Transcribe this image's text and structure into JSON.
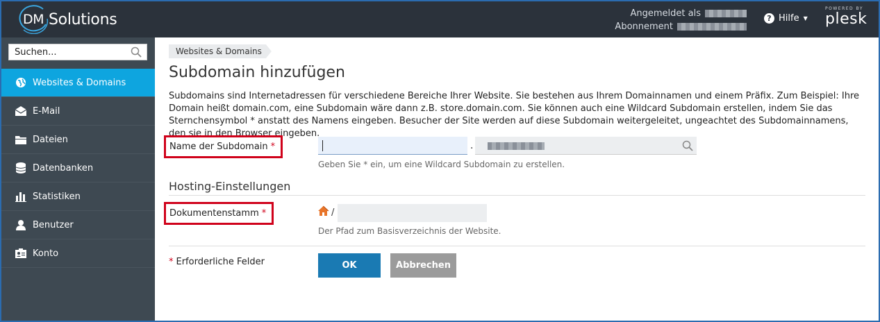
{
  "header": {
    "logo_dm": "DM",
    "logo_solutions": "Solutions",
    "logged_in_label": "Angemeldet als",
    "subscription_label": "Abonnement",
    "help_label": "Hilfe",
    "powered_by": "POWERED BY",
    "plesk": "plesk"
  },
  "sidebar": {
    "search_placeholder": "Suchen...",
    "items": [
      {
        "label": "Websites & Domains",
        "icon": "globe-icon",
        "active": true
      },
      {
        "label": "E-Mail",
        "icon": "envelope-icon"
      },
      {
        "label": "Dateien",
        "icon": "folder-icon"
      },
      {
        "label": "Datenbanken",
        "icon": "database-icon"
      },
      {
        "label": "Statistiken",
        "icon": "bar-chart-icon"
      },
      {
        "label": "Benutzer",
        "icon": "user-icon"
      },
      {
        "label": "Konto",
        "icon": "account-card-icon"
      }
    ]
  },
  "main": {
    "breadcrumb": "Websites & Domains",
    "title": "Subdomain hinzufügen",
    "description": "Subdomains sind Internetadressen für verschiedene Bereiche Ihrer Website. Sie bestehen aus Ihrem Domainnamen und einem Präfix. Zum Beispiel: Ihre Domain heißt domain.com, eine Subdomain wäre dann z.B. store.domain.com. Sie können auch eine Wildcard Subdomain erstellen, indem Sie das Sternchensymbol * anstatt des Namens eingeben. Besucher der Site werden auf diese Subdomain weitergeleitet, ungeachtet des Subdomainnamens, den sie in den Browser eingeben.",
    "subdomain_label": "Name der Subdomain",
    "required_star": "*",
    "dot": ".",
    "subdomain_hint": "Geben Sie * ein, um eine Wildcard Subdomain zu erstellen.",
    "hosting_section": "Hosting-Einstellungen",
    "docroot_label": "Dokumentenstamm",
    "slash": "/",
    "docroot_hint": "Der Pfad zum Basisverzeichnis der Website.",
    "required_fields": "Erforderliche Felder",
    "ok_label": "OK",
    "cancel_label": "Abbrechen"
  },
  "colors": {
    "header_bg": "#2b323b",
    "sidebar_bg": "#3e4952",
    "active_item": "#0ea5df",
    "ok_button": "#1a7ab3",
    "cancel_button": "#9b9b9b",
    "highlight_border": "#d0021b"
  }
}
